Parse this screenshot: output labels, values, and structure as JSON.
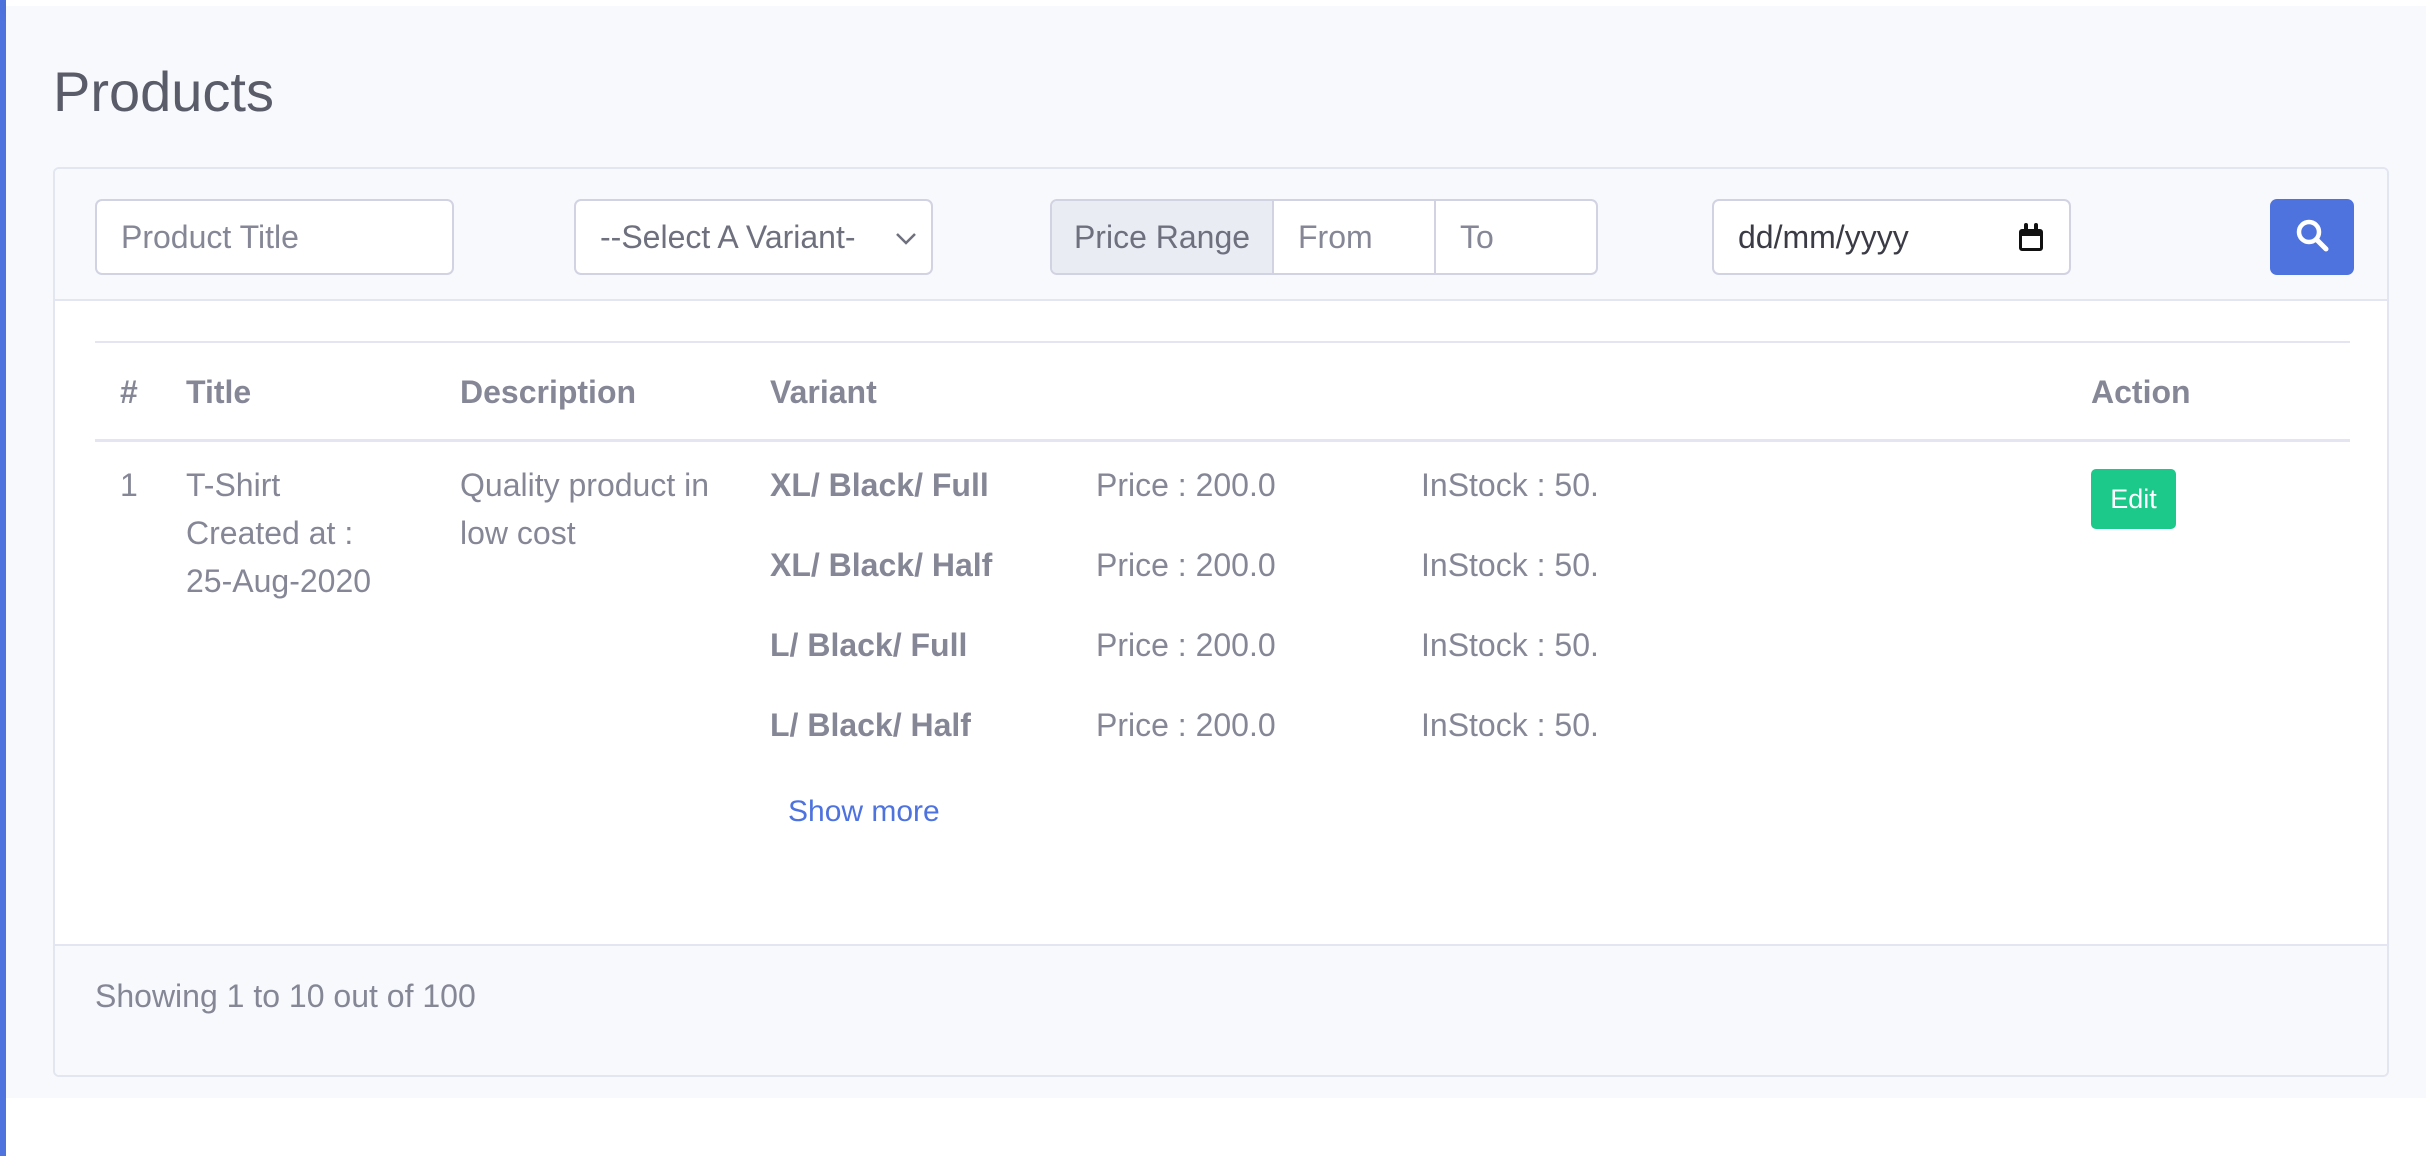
{
  "page": {
    "title": "Products"
  },
  "filters": {
    "product_title_placeholder": "Product Title",
    "variant_select_value": "--Select A Variant-",
    "price_range_label": "Price Range",
    "price_from_placeholder": "From",
    "price_to_placeholder": "To",
    "date_placeholder": "dd/mm/yyyy",
    "search_icon": "search-icon"
  },
  "table": {
    "headers": [
      "#",
      "Title",
      "Description",
      "Variant",
      "Action"
    ],
    "rows": [
      {
        "index": "1",
        "title": "T-Shirt",
        "created_label": "Created at :",
        "created_date": "25-Aug-2020",
        "description_line1": "Quality product in",
        "description_line2": "low cost",
        "variants": [
          {
            "name": "XL/ Black/ Full",
            "price": "Price : 200.0",
            "stock": "InStock : 50."
          },
          {
            "name": "XL/ Black/ Half",
            "price": "Price : 200.0",
            "stock": "InStock : 50."
          },
          {
            "name": "L/ Black/ Full",
            "price": "Price : 200.0",
            "stock": "InStock : 50."
          },
          {
            "name": "L/ Black/ Half",
            "price": "Price : 200.0",
            "stock": "InStock : 50."
          }
        ],
        "show_more": "Show more",
        "action_label": "Edit"
      }
    ]
  },
  "footer": {
    "summary": "Showing 1 to 10 out of 100"
  },
  "colors": {
    "primary": "#4e73df",
    "success": "#1cc88a",
    "text": "#858796",
    "background": "#f8f9fc"
  }
}
